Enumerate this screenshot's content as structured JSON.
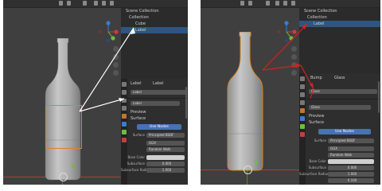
{
  "colors": {
    "selection_orange": "#d4842a",
    "annotation_left": "#ffffff",
    "annotation_right": "#d62020",
    "accent_blue": "#4772b3",
    "axis_x": "#d6353d",
    "axis_y": "#6fbd3a",
    "axis_z": "#3a7bd5"
  },
  "left": {
    "outliner": {
      "title": "Scene Collection",
      "collection": "Collection",
      "items": [
        "Cube",
        "Label"
      ]
    },
    "props": {
      "obj_a": "Label",
      "obj_b": "Label",
      "name": "Label",
      "mat": "Label",
      "preview": "Preview",
      "surface": "Surface",
      "use_nodes": "Use Nodes",
      "surface_label": "Surface",
      "surface_val": "Principled BSDF",
      "ggx": "GGX",
      "rw": "Random Walk",
      "base_color": "Base Color",
      "subsurface": "Subsurface",
      "sub_val": "0.000",
      "sub_radius": "Subsurface Radius",
      "sr_val": "1.000"
    }
  },
  "right": {
    "outliner": {
      "title": "Scene Collection",
      "collection": "Collection",
      "items": [
        "Label"
      ]
    },
    "props": {
      "obj_a": "Bump",
      "obj_b": "Glass",
      "name": "Glass",
      "mat": "Glass",
      "preview": "Preview",
      "surface": "Surface",
      "use_nodes": "Use Nodes",
      "surface_label": "Surface",
      "surface_val": "Principled BSDF",
      "ggx": "GGX",
      "rw": "Random Walk",
      "base_color": "Base Color",
      "subsurface": "Subsurface",
      "sub_val": "0.000",
      "sub_radius": "Subsurface Radius",
      "sr_val": "1.000",
      "extra_val": "0.100"
    }
  }
}
